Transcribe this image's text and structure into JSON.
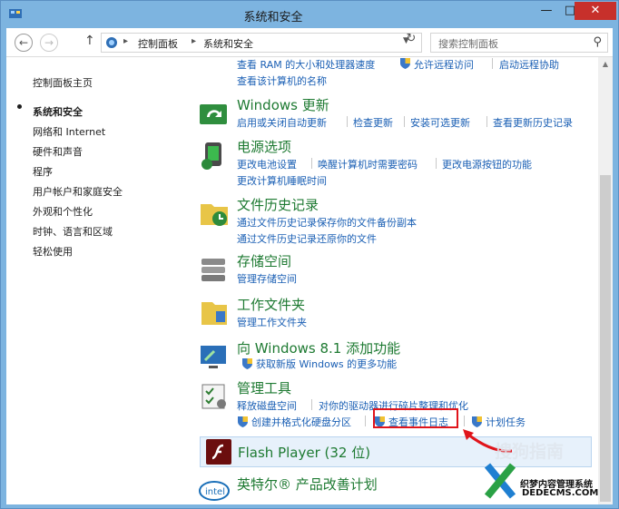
{
  "window": {
    "title": "系统和安全"
  },
  "nav": {
    "breadcrumb": [
      "控制面板",
      "系统和安全"
    ],
    "search_placeholder": "搜索控制面板"
  },
  "sidebar": {
    "items": [
      {
        "label": "控制面板主页"
      },
      {
        "label": "系统和安全",
        "current": true
      },
      {
        "label": "网络和 Internet"
      },
      {
        "label": "硬件和声音"
      },
      {
        "label": "程序"
      },
      {
        "label": "用户帐户和家庭安全"
      },
      {
        "label": "外观和个性化"
      },
      {
        "label": "时钟、语言和区域"
      },
      {
        "label": "轻松使用"
      }
    ]
  },
  "main": {
    "partial_top": {
      "row1": [
        "查看 RAM 的大小和处理器速度",
        "允许远程访问",
        "启动远程协助"
      ],
      "row2": [
        "查看该计算机的名称"
      ]
    },
    "windows_update": {
      "title": "Windows 更新",
      "links": [
        "启用或关闭自动更新",
        "检查更新",
        "安装可选更新",
        "查看更新历史记录"
      ]
    },
    "power": {
      "title": "电源选项",
      "links": [
        "更改电池设置",
        "唤醒计算机时需要密码",
        "更改电源按钮的功能",
        "更改计算机睡眠时间"
      ]
    },
    "file_history": {
      "title": "文件历史记录",
      "links": [
        "通过文件历史记录保存你的文件备份副本",
        "通过文件历史记录还原你的文件"
      ]
    },
    "storage": {
      "title": "存储空间",
      "links": [
        "管理存储空间"
      ]
    },
    "work_folders": {
      "title": "工作文件夹",
      "links": [
        "管理工作文件夹"
      ]
    },
    "add_features": {
      "title": "向 Windows 8.1 添加功能",
      "links": [
        "获取新版 Windows 的更多功能"
      ]
    },
    "admin_tools": {
      "title": "管理工具",
      "links": [
        "释放磁盘空间",
        "对你的驱动器进行碎片整理和优化",
        "创建并格式化硬盘分区",
        "查看事件日志",
        "计划任务"
      ]
    },
    "flash": {
      "title": "Flash Player (32 位)"
    },
    "intel": {
      "title": "英特尔® 产品改善计划"
    }
  },
  "watermark": {
    "sogou": "搜狗指南",
    "site_cn": "织梦内容管理系统",
    "site_en": "DEDECMS.COM"
  }
}
